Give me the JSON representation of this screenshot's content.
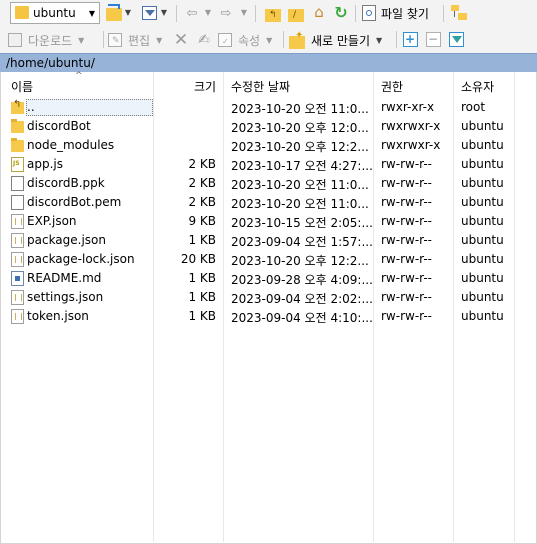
{
  "toolbar1": {
    "location": "ubuntu",
    "find_files": "파일 찾기"
  },
  "toolbar2": {
    "download": "다운로드",
    "edit": "편집",
    "properties": "속성",
    "new": "새로 만들기"
  },
  "path": "/home/ubuntu/",
  "columns": {
    "name": "이름",
    "size": "크기",
    "modified": "수정한 날짜",
    "rights": "권한",
    "owner": "소유자"
  },
  "files": [
    {
      "name": "..",
      "size": "",
      "modified": "2023-10-20 오전 11:0...",
      "rights": "rwxr-xr-x",
      "owner": "root",
      "icon": "parent-dir-icon"
    },
    {
      "name": "discordBot",
      "size": "",
      "modified": "2023-10-20 오후 12:0...",
      "rights": "rwxrwxr-x",
      "owner": "ubuntu",
      "icon": "folder-icon"
    },
    {
      "name": "node_modules",
      "size": "",
      "modified": "2023-10-20 오후 12:2...",
      "rights": "rwxrwxr-x",
      "owner": "ubuntu",
      "icon": "folder-icon"
    },
    {
      "name": "app.js",
      "size": "2 KB",
      "modified": "2023-10-17 오전 4:27:...",
      "rights": "rw-rw-r--",
      "owner": "ubuntu",
      "icon": "js-file-icon"
    },
    {
      "name": "discordB.ppk",
      "size": "2 KB",
      "modified": "2023-10-20 오전 11:0...",
      "rights": "rw-rw-r--",
      "owner": "ubuntu",
      "icon": "file-icon"
    },
    {
      "name": "discordBot.pem",
      "size": "2 KB",
      "modified": "2023-10-20 오전 11:0...",
      "rights": "rw-rw-r--",
      "owner": "ubuntu",
      "icon": "file-icon"
    },
    {
      "name": "EXP.json",
      "size": "9 KB",
      "modified": "2023-10-15 오전 2:05:...",
      "rights": "rw-rw-r--",
      "owner": "ubuntu",
      "icon": "json-file-icon"
    },
    {
      "name": "package.json",
      "size": "1 KB",
      "modified": "2023-09-04 오전 1:57:...",
      "rights": "rw-rw-r--",
      "owner": "ubuntu",
      "icon": "json-file-icon"
    },
    {
      "name": "package-lock.json",
      "size": "20 KB",
      "modified": "2023-10-20 오후 12:2...",
      "rights": "rw-rw-r--",
      "owner": "ubuntu",
      "icon": "json-file-icon"
    },
    {
      "name": "README.md",
      "size": "1 KB",
      "modified": "2023-09-28 오후 4:09:...",
      "rights": "rw-rw-r--",
      "owner": "ubuntu",
      "icon": "md-file-icon"
    },
    {
      "name": "settings.json",
      "size": "1 KB",
      "modified": "2023-09-04 오전 2:02:...",
      "rights": "rw-rw-r--",
      "owner": "ubuntu",
      "icon": "json-file-icon"
    },
    {
      "name": "token.json",
      "size": "1 KB",
      "modified": "2023-09-04 오전 4:10:...",
      "rights": "rw-rw-r--",
      "owner": "ubuntu",
      "icon": "json-file-icon"
    }
  ],
  "colors": {
    "path_bar": "#97b4d8",
    "folder": "#f7c94a",
    "refresh_green": "#3aa83a",
    "new_blue": "#2f8fd0"
  }
}
